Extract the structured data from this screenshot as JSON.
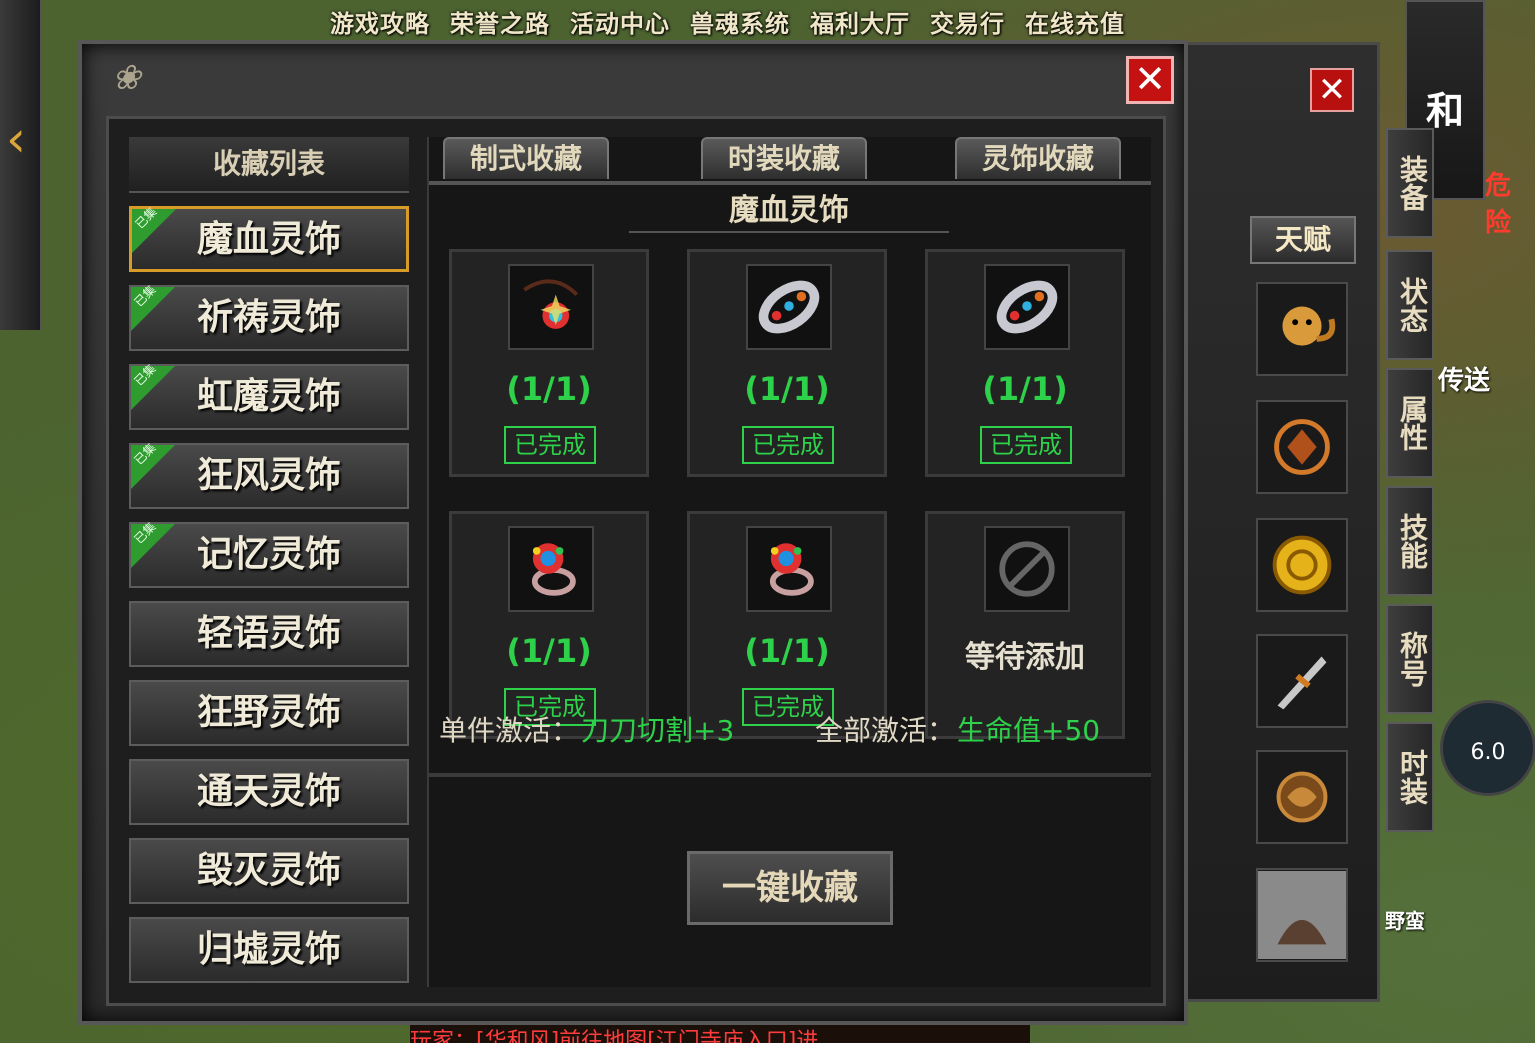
{
  "top_menu": [
    "游戏攻略",
    "荣誉之路",
    "活动中心",
    "兽魂系统",
    "福利大厅",
    "交易行",
    "在线充值"
  ],
  "window": {
    "close_label": "✕",
    "list_title": "收藏列表",
    "badge_text": "已集",
    "list_items": [
      {
        "label": "魔血灵饰",
        "active": true,
        "badge": true
      },
      {
        "label": "祈祷灵饰",
        "active": false,
        "badge": true
      },
      {
        "label": "虹魔灵饰",
        "active": false,
        "badge": true
      },
      {
        "label": "狂风灵饰",
        "active": false,
        "badge": true
      },
      {
        "label": "记忆灵饰",
        "active": false,
        "badge": true
      },
      {
        "label": "轻语灵饰",
        "active": false,
        "badge": false
      },
      {
        "label": "狂野灵饰",
        "active": false,
        "badge": false
      },
      {
        "label": "通天灵饰",
        "active": false,
        "badge": false
      },
      {
        "label": "毁灭灵饰",
        "active": false,
        "badge": false
      },
      {
        "label": "归墟灵饰",
        "active": false,
        "badge": false
      }
    ],
    "tabs": [
      "制式收藏",
      "时装收藏",
      "灵饰收藏"
    ],
    "section_title": "魔血灵饰",
    "cards": [
      {
        "icon": "necklace-icon",
        "count": "(1/1)",
        "status": "已完成"
      },
      {
        "icon": "bracelet-icon",
        "count": "(1/1)",
        "status": "已完成"
      },
      {
        "icon": "bracelet-icon",
        "count": "(1/1)",
        "status": "已完成"
      },
      {
        "icon": "ring-icon",
        "count": "(1/1)",
        "status": "已完成"
      },
      {
        "icon": "ring-icon",
        "count": "(1/1)",
        "status": "已完成"
      },
      {
        "icon": "empty-slot-icon",
        "count": "",
        "status": "等待添加"
      }
    ],
    "single_label": "单件激活：",
    "single_value": "刀刀切割+3",
    "all_label": "全部激活：",
    "all_value": "生命值+50",
    "collect_button": "一键收藏"
  },
  "side_panel": {
    "close_label": "✕",
    "talent_label": "天赋",
    "tabs": [
      "装备",
      "状态",
      "属性",
      "技能",
      "称号",
      "时装"
    ],
    "corner_char": "和",
    "danger_text": "危险",
    "teleport_text": "传送",
    "level_text": "6.0",
    "wild_text": "野蛮"
  },
  "chat_text": "玩家：[华和风]前往地图[江门寺庙入口]进"
}
